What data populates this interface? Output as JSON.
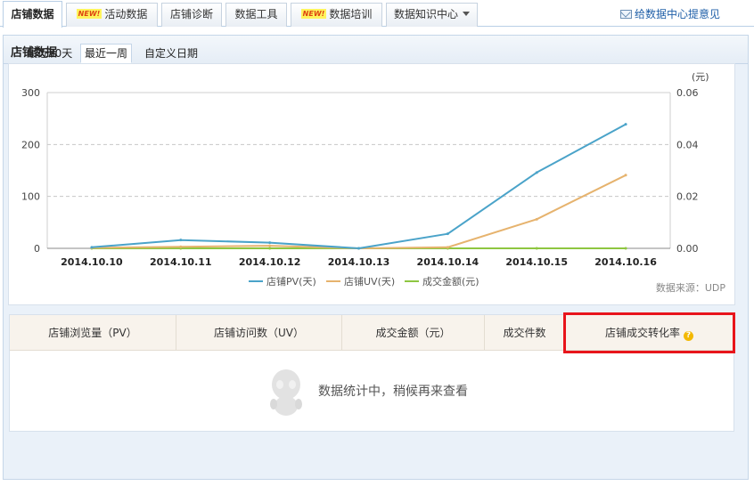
{
  "tabs": [
    {
      "label": "店铺数据",
      "active": true,
      "is_new": false
    },
    {
      "label": "活动数据",
      "active": false,
      "is_new": true
    },
    {
      "label": "店铺诊断",
      "active": false,
      "is_new": false
    },
    {
      "label": "数据工具",
      "active": false,
      "is_new": false
    },
    {
      "label": "数据培训",
      "active": false,
      "is_new": true
    },
    {
      "label": "数据知识中心",
      "active": false,
      "is_new": false,
      "dropdown": true
    }
  ],
  "new_badge": "NEW!",
  "feedback_link": "给数据中心提意见",
  "panel_title": "店铺数据",
  "range_tabs": [
    {
      "label": "最近30天",
      "active": false
    },
    {
      "label": "最近一周",
      "active": true
    },
    {
      "label": "自定义日期",
      "active": false
    }
  ],
  "chart_data": {
    "type": "line",
    "categories": [
      "2014.10.10",
      "2014.10.11",
      "2014.10.12",
      "2014.10.13",
      "2014.10.14",
      "2014.10.15",
      "2014.10.16"
    ],
    "left_axis": {
      "range": [
        0,
        300
      ],
      "ticks": [
        "0",
        "100",
        "200",
        "300"
      ]
    },
    "right_axis": {
      "range": [
        0,
        0.06
      ],
      "ticks": [
        "0.00",
        "0.02",
        "0.04",
        "0.06"
      ],
      "unit": "(元)"
    },
    "series": [
      {
        "name": "店铺PV(天)",
        "color": "#4aa3c9",
        "axis": "left",
        "values": [
          2,
          16,
          11,
          0,
          28,
          146,
          239
        ]
      },
      {
        "name": "店铺UV(天)",
        "color": "#e6b36e",
        "axis": "left",
        "values": [
          1,
          3,
          5,
          0,
          2,
          56,
          141
        ]
      },
      {
        "name": "成交金额(元)",
        "color": "#8ec641",
        "axis": "right",
        "values": [
          0,
          0,
          0,
          0,
          0,
          0,
          0
        ]
      }
    ],
    "grid": true,
    "legend_position": "bottom"
  },
  "data_source": "数据来源：UDP",
  "metrics": {
    "columns": [
      "店铺浏览量（PV）",
      "店铺访问数（UV）",
      "成交金额（元）",
      "成交件数",
      "店铺成交转化率"
    ],
    "empty_message": "数据统计中，稍候再来查看"
  },
  "colors": {
    "accent_blue": "#1f5fa8",
    "highlight": "#e8141b"
  }
}
